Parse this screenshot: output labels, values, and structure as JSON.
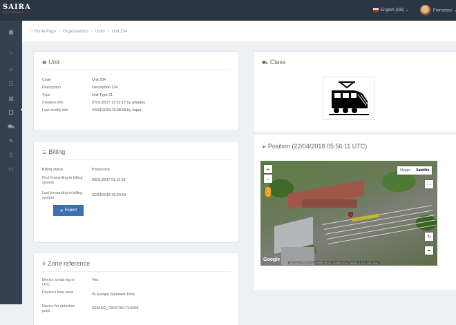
{
  "topbar": {
    "logo_main": "SAIRA",
    "logo_sub": "ELECTRONICS",
    "language": "English (GB)",
    "user_name": "Francesco"
  },
  "sidebar": {
    "items": [
      "dashboard-icon",
      "home-icon",
      "users-icon",
      "file-icon",
      "device-icon",
      "car-icon",
      "wrench-icon",
      "document-icon",
      "monitor-icon"
    ],
    "active_index": 4
  },
  "breadcrumb": [
    "Home Page",
    "Organizations",
    "Units",
    "Unit 234"
  ],
  "unit": {
    "title": "Unit",
    "rows": [
      {
        "k": "Code",
        "v": "Unit 234"
      },
      {
        "k": "Description",
        "v": "Description 234"
      },
      {
        "k": "Type",
        "v": "Unit Type 21"
      },
      {
        "k": "Creation info",
        "v": "07/11/2017 12:52:17 by amadeo"
      },
      {
        "k": "Last modify info",
        "v": "24/04/2018 15:38:08 by super"
      }
    ]
  },
  "billing": {
    "title": "Billing",
    "rows": [
      {
        "k": "Billing status",
        "v": "Production"
      },
      {
        "k": "First forwarding to billing system",
        "v": "09/11/2017 01:11:59"
      },
      {
        "k": "Last forwarding to billing system",
        "v": "22/04/2018 02:24:54"
      }
    ],
    "export_label": "Export"
  },
  "zone": {
    "title": "Zone reference",
    "rows": [
      {
        "k": "Device sends log in UTC",
        "v": "Yes"
      },
      {
        "k": "Device's time zone",
        "v": "W. Europe Standard Time"
      },
      {
        "k": "Device for detection point",
        "v": "REM102_0302745171:5005"
      }
    ]
  },
  "class_panel": {
    "title": "Class",
    "image_icon": "train-icon"
  },
  "position": {
    "title": "Position (22/04/2018 05:56:11 UTC)",
    "map_type_options": [
      "Mappa",
      "Satellite"
    ],
    "map_type_selected": "Satellite",
    "google_label": "Google",
    "attribution": "Dati mappa ©2018 Immagini ©2018 | Termini e condizioni d'uso | Segnala un errore nella mappa"
  }
}
